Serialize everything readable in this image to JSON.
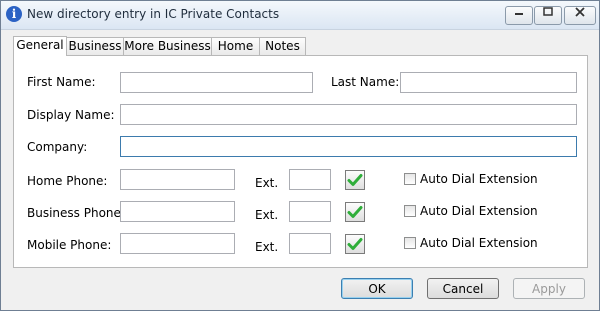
{
  "window": {
    "title": "New directory entry in IC Private Contacts",
    "minimize_icon": "minimize-icon",
    "maximize_icon": "maximize-icon",
    "close_icon": "close-icon"
  },
  "tabs": [
    {
      "label": "General",
      "active": true
    },
    {
      "label": "Business",
      "active": false
    },
    {
      "label": "More Business",
      "active": false
    },
    {
      "label": "Home",
      "active": false
    },
    {
      "label": "Notes",
      "active": false
    }
  ],
  "form": {
    "first_name_label": "First Name:",
    "first_name_value": "",
    "last_name_label": "Last Name:",
    "last_name_value": "",
    "display_name_label": "Display Name:",
    "display_name_value": "",
    "company_label": "Company:",
    "company_value": "",
    "phones": [
      {
        "label": "Home Phone:",
        "value": "",
        "ext_label": "Ext.",
        "ext_value": "",
        "auto_dial_label": "Auto Dial Extension",
        "auto_dial_checked": false
      },
      {
        "label": "Business Phone:",
        "value": "",
        "ext_label": "Ext.",
        "ext_value": "",
        "auto_dial_label": "Auto Dial Extension",
        "auto_dial_checked": false
      },
      {
        "label": "Mobile Phone:",
        "value": "",
        "ext_label": "Ext.",
        "ext_value": "",
        "auto_dial_label": "Auto Dial Extension",
        "auto_dial_checked": false
      }
    ],
    "validate_icon": "checkmark-icon",
    "check_color": "#2fae3a"
  },
  "buttons": {
    "ok": "OK",
    "cancel": "Cancel",
    "apply": "Apply",
    "apply_enabled": false
  }
}
